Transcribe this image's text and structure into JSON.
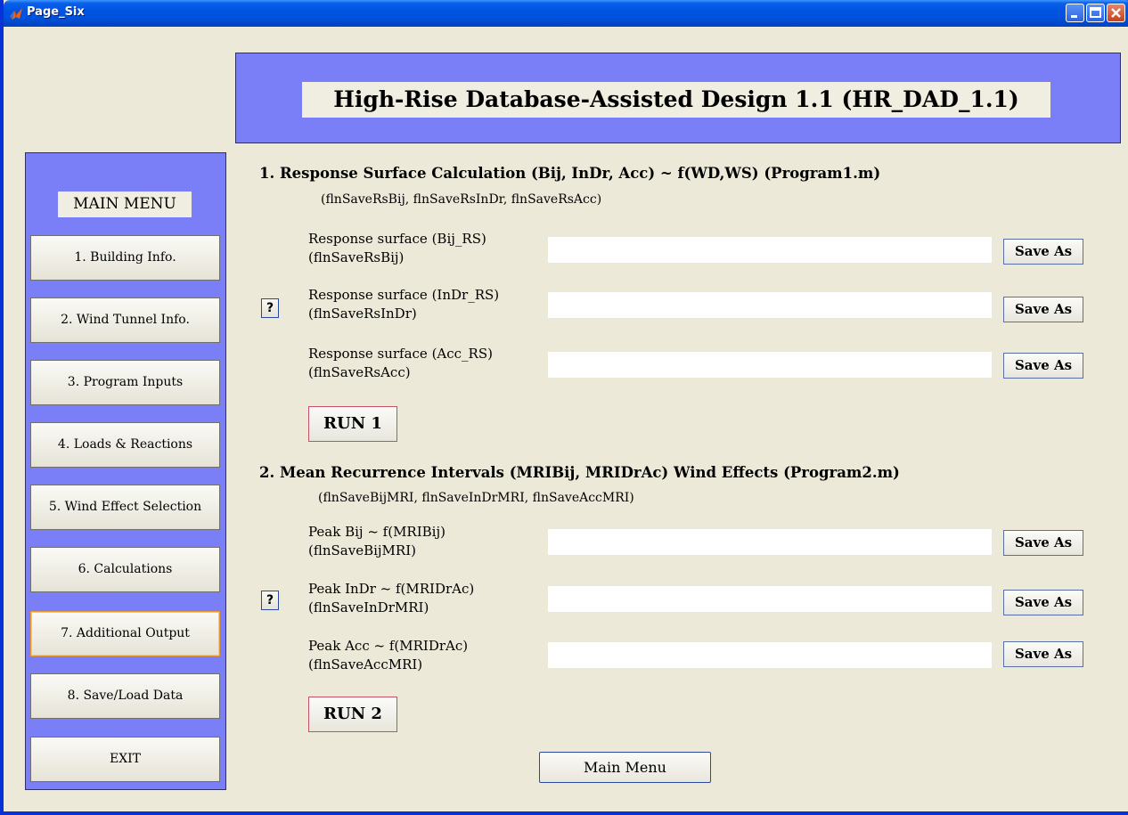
{
  "window": {
    "title": "Page_Six"
  },
  "header": {
    "title": "High-Rise Database-Assisted Design 1.1 (HR_DAD_1.1)"
  },
  "menu": {
    "title": "MAIN MENU",
    "items": [
      {
        "label": "1. Building Info."
      },
      {
        "label": "2. Wind Tunnel Info."
      },
      {
        "label": "3. Program Inputs"
      },
      {
        "label": "4. Loads & Reactions"
      },
      {
        "label": "5. Wind Effect Selection"
      },
      {
        "label": "6. Calculations"
      },
      {
        "label": "7.  Additional Output"
      },
      {
        "label": "8. Save/Load Data"
      },
      {
        "label": "EXIT"
      }
    ]
  },
  "section1": {
    "title": "1. Response Surface Calculation (Bij, InDr, Acc) ~ f(WD,WS) (Program1.m)",
    "subtitle": "(flnSaveRsBij, flnSaveRsInDr, flnSaveRsAcc)",
    "rows": [
      {
        "label1": "Response surface (Bij_RS)",
        "label2": "(flnSaveRsBij)",
        "value": "",
        "button": "Save As"
      },
      {
        "label1": "Response surface (InDr_RS)",
        "label2": "(flnSaveRsInDr)",
        "value": "",
        "button": "Save As"
      },
      {
        "label1": "Response surface (Acc_RS)",
        "label2": "(flnSaveRsAcc)",
        "value": "",
        "button": "Save As"
      }
    ],
    "help": "?",
    "run": "RUN 1"
  },
  "section2": {
    "title": "2. Mean Recurrence Intervals (MRIBij, MRIDrAc) Wind Effects (Program2.m)",
    "subtitle": "(flnSaveBijMRI, flnSaveInDrMRI, flnSaveAccMRI)",
    "rows": [
      {
        "label1": "Peak Bij ~ f(MRIBij)",
        "label2": "(flnSaveBijMRI)",
        "value": "",
        "button": "Save As"
      },
      {
        "label1": "Peak InDr ~ f(MRIDrAc)",
        "label2": "(flnSaveInDrMRI)",
        "value": "",
        "button": "Save As"
      },
      {
        "label1": "Peak Acc ~ f(MRIDrAc)",
        "label2": "(flnSaveAccMRI)",
        "value": "",
        "button": "Save As"
      }
    ],
    "help": "?",
    "run": "RUN 2"
  },
  "footer": {
    "main_menu": "Main Menu"
  },
  "colors": {
    "panel": "#7b7ff7",
    "background": "#ece9d8",
    "titlebar": "#0054e3"
  }
}
